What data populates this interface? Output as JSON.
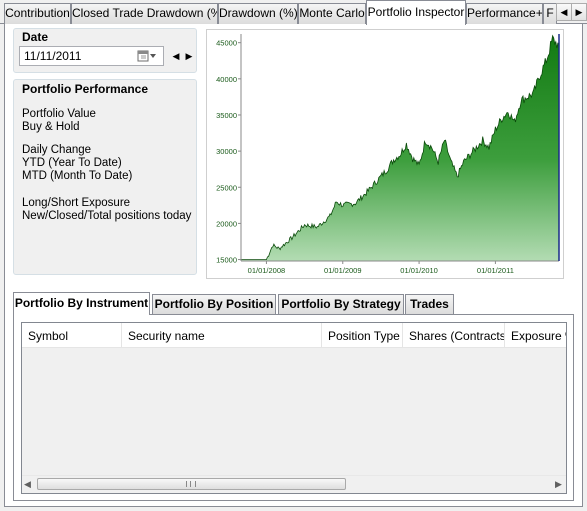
{
  "tabs": [
    {
      "label": "Contribution",
      "active": false
    },
    {
      "label": "Closed Trade Drawdown (%)",
      "active": false
    },
    {
      "label": "Drawdown (%)",
      "active": false
    },
    {
      "label": "Monte Carlo",
      "active": false
    },
    {
      "label": "Portfolio Inspector",
      "active": true
    },
    {
      "label": "Performance+",
      "active": false
    },
    {
      "label": "F",
      "active": false
    }
  ],
  "date_group": {
    "title": "Date",
    "date_value": "11/11/2011"
  },
  "performance_group": {
    "title": "Portfolio Performance",
    "lines": [
      "Portfolio Value",
      "Buy & Hold",
      "Daily Change",
      "YTD (Year To Date)",
      "MTD (Month To Date)",
      "Long/Short Exposure",
      "New/Closed/Total positions today"
    ]
  },
  "chart_data": {
    "type": "area",
    "title": "",
    "xlabel": "",
    "ylabel": "",
    "x_ticks": [
      "01/01/2008",
      "01/01/2009",
      "01/01/2010",
      "01/01/2011"
    ],
    "y_ticks": [
      15000,
      20000,
      25000,
      30000,
      35000,
      40000,
      45000
    ],
    "ylim": [
      14800,
      46200
    ],
    "x_range": [
      "09/2007",
      "11/2011"
    ],
    "series": [
      {
        "values_by_month": [
          [
            "09/2007",
            15000
          ],
          [
            "12/2007",
            15000
          ],
          [
            "01/2008",
            15000
          ],
          [
            "02/2008",
            17000
          ],
          [
            "03/2008",
            16500
          ],
          [
            "05/2008",
            18000
          ],
          [
            "07/2008",
            19800
          ],
          [
            "09/2008",
            19500
          ],
          [
            "11/2008",
            21000
          ],
          [
            "12/2008",
            23000
          ],
          [
            "01/2009",
            22500
          ],
          [
            "03/2009",
            22800
          ],
          [
            "05/2009",
            24500
          ],
          [
            "07/2009",
            26500
          ],
          [
            "08/2009",
            27500
          ],
          [
            "09/2009",
            28800
          ],
          [
            "10/2009",
            29500
          ],
          [
            "11/2009",
            31000
          ],
          [
            "12/2009",
            29000
          ],
          [
            "01/2010",
            28000
          ],
          [
            "02/2010",
            31500
          ],
          [
            "03/2010",
            30500
          ],
          [
            "04/2010",
            28500
          ],
          [
            "05/2010",
            31500
          ],
          [
            "06/2010",
            28500
          ],
          [
            "07/2010",
            26500
          ],
          [
            "08/2010",
            28500
          ],
          [
            "09/2010",
            29500
          ],
          [
            "10/2010",
            30500
          ],
          [
            "11/2010",
            31500
          ],
          [
            "12/2010",
            30500
          ],
          [
            "01/2011",
            33000
          ],
          [
            "02/2011",
            34500
          ],
          [
            "03/2011",
            35500
          ],
          [
            "04/2011",
            34000
          ],
          [
            "05/2011",
            37000
          ],
          [
            "06/2011",
            37500
          ],
          [
            "07/2011",
            38000
          ],
          [
            "08/2011",
            40500
          ],
          [
            "09/2011",
            42500
          ],
          [
            "10/2011",
            45500
          ],
          [
            "11/2011",
            44500
          ]
        ]
      }
    ],
    "fill_color": "#1f8a1f",
    "line_color": "#0a4a0a",
    "grid": false
  },
  "bottom_tabs": [
    {
      "label": "Portfolio By Instrument",
      "active": true
    },
    {
      "label": "Portfolio By Position",
      "active": false
    },
    {
      "label": "Portfolio By Strategy",
      "active": false
    },
    {
      "label": "Trades",
      "active": false
    }
  ],
  "grid_columns": [
    "Symbol",
    "Security name",
    "Position Type",
    "Shares (Contracts)",
    "Exposure %"
  ]
}
